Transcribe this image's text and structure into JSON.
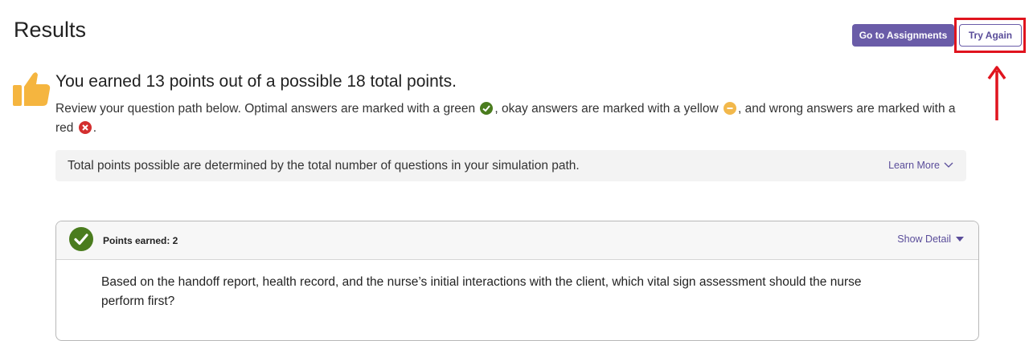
{
  "header": {
    "title": "Results",
    "go_to_assignments_label": "Go to Assignments",
    "try_again_label": "Try Again"
  },
  "summary": {
    "headline": "You earned 13 points out of a possible 18 total points.",
    "review_part1": "Review your question path below. Optimal answers are marked with a green",
    "review_part2": ", okay answers are marked with a yellow",
    "review_part3": ", and wrong answers are marked with a red",
    "review_part4": ".",
    "icons": {
      "optimal": "check-circle-icon",
      "okay": "minus-circle-icon",
      "wrong": "x-circle-icon"
    }
  },
  "info_bar": {
    "text": "Total points possible are determined by the total number of questions in your simulation path.",
    "learn_more_label": "Learn More"
  },
  "question_card": {
    "points_label": "Points earned: 2",
    "show_detail_label": "Show Detail",
    "question_text": "Based on the handoff report, health record, and the nurse’s initial interactions with the client, which vital sign assessment should the nurse perform first?"
  },
  "colors": {
    "accent": "#6a5ca8",
    "optimal_green": "#4a7c1e",
    "okay_yellow": "#f2b84b",
    "wrong_red": "#d32f2f",
    "annotation_red": "#e0141e",
    "thumb_gold": "#f5b53f"
  }
}
